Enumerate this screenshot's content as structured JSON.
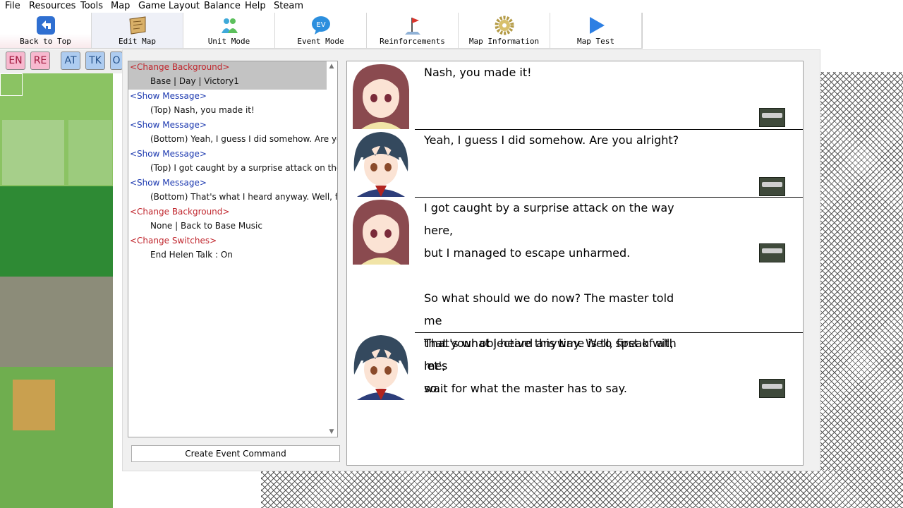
{
  "menu": [
    "File",
    "Resources",
    "Tools",
    "Map",
    "Game Layout",
    "Balance",
    "Help",
    "Steam"
  ],
  "toolbar": [
    {
      "label": "Back to Top",
      "icon": "back-arrow-icon"
    },
    {
      "label": "Edit Map",
      "icon": "map-scroll-icon"
    },
    {
      "label": "Unit Mode",
      "icon": "units-icon"
    },
    {
      "label": "Event Mode",
      "icon": "event-bubble-icon"
    },
    {
      "label": "Reinforcements",
      "icon": "flag-icon"
    },
    {
      "label": "Map Information",
      "icon": "gear-icon"
    },
    {
      "label": "Map Test",
      "icon": "play-icon"
    }
  ],
  "layers": [
    "EN",
    "RE",
    "AT",
    "TK",
    "O"
  ],
  "commands": [
    {
      "type": "<Change Background>",
      "detail": "Base | Day | Victory1",
      "color": "red"
    },
    {
      "type": "<Show Message>",
      "detail": "(Top) Nash, you made it!",
      "color": "blue"
    },
    {
      "type": "<Show Message>",
      "detail": "(Bottom) Yeah, I guess I did somehow. Are you alright?",
      "color": "blue"
    },
    {
      "type": "<Show Message>",
      "detail": "(Top) I got caught by a surprise attack on the way here,",
      "color": "blue"
    },
    {
      "type": "<Show Message>",
      "detail": "(Bottom) That's what I heard anyway. Well, first of all, let's",
      "color": "blue"
    },
    {
      "type": "<Change Background>",
      "detail": "None | Back to Base Music",
      "color": "red"
    },
    {
      "type": "<Change Switches>",
      "detail": "End Helen Talk : On",
      "color": "red"
    }
  ],
  "create_button": "Create Event Command",
  "messages": [
    {
      "speaker": "helen",
      "text": "Nash, you made it!"
    },
    {
      "speaker": "nash",
      "text": "Yeah, I guess I did somehow. Are you alright?"
    },
    {
      "speaker": "helen",
      "text": "I got caught by a surprise attack on the way here,\nbut I managed to escape unharmed.\n\nSo what should we do now? The master told me\nthat your objective this time is to speak with me,\nso..."
    },
    {
      "speaker": "nash",
      "text": "That's what I heard anyway. Well, first of all, let's\nwait for what the master has to say."
    }
  ],
  "colors": {
    "command_red": "#c0262d",
    "command_blue": "#1d3ab0",
    "selection": "#c3c3c3",
    "grass": "#7cb659"
  }
}
